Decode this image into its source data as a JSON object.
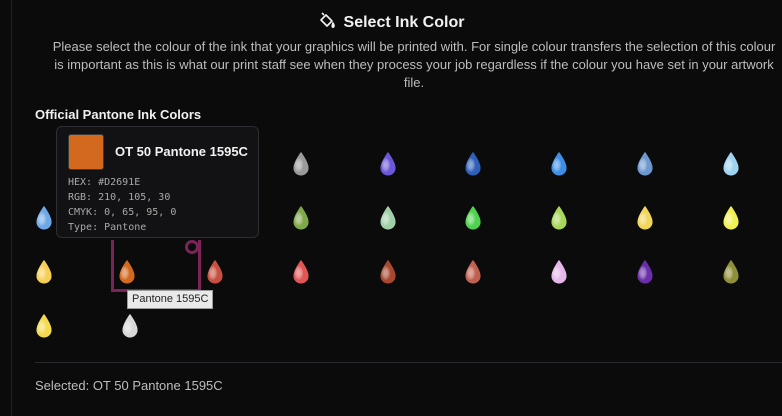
{
  "header": {
    "title": "Select Ink Color",
    "icon": "paint-bucket-icon",
    "description_lines": [
      "Please select the colour of the ink that your graphics will be printed with. For single colour transfers the selection of this colour",
      "is important as this is what our print staff see when they process your job regardless if the colour you have set in your artwork",
      "file."
    ]
  },
  "section": {
    "title": "Official Pantone Ink Colors"
  },
  "swatch_colors": [
    "#9a9a9a",
    "#6b57d8",
    "#2f5fb8",
    "#3f8fe6",
    "#6c97cf",
    "#9fd3f0",
    "#6fa8e8",
    "#7fa84a",
    "#9fd0a8",
    "#4fd24f",
    "#a8d85a",
    "#f1d65a",
    "#f0f055",
    "#f6cf55",
    "#d2691e",
    "#c85040",
    "#e05555",
    "#a84830",
    "#c06050",
    "#e6b7e9",
    "#6a2ea8",
    "#8f8f3a",
    "#f3da4f",
    "#d8d8d8"
  ],
  "tooltip": {
    "name": "OT 50 Pantone 1595C",
    "color": "#D2691E",
    "hex_line": "HEX: #D2691E",
    "rgb_line": "RGB: 210, 105, 30",
    "cmyk_line": "CMYK: 0, 65, 95, 0",
    "type_line": "Type: Pantone"
  },
  "hover_label": "Pantone 1595C",
  "footer": {
    "selected_text": "Selected: OT 50 Pantone 1595C"
  },
  "colors": {
    "background": "#0b0b0c",
    "hover_frame": "#7a2458"
  }
}
